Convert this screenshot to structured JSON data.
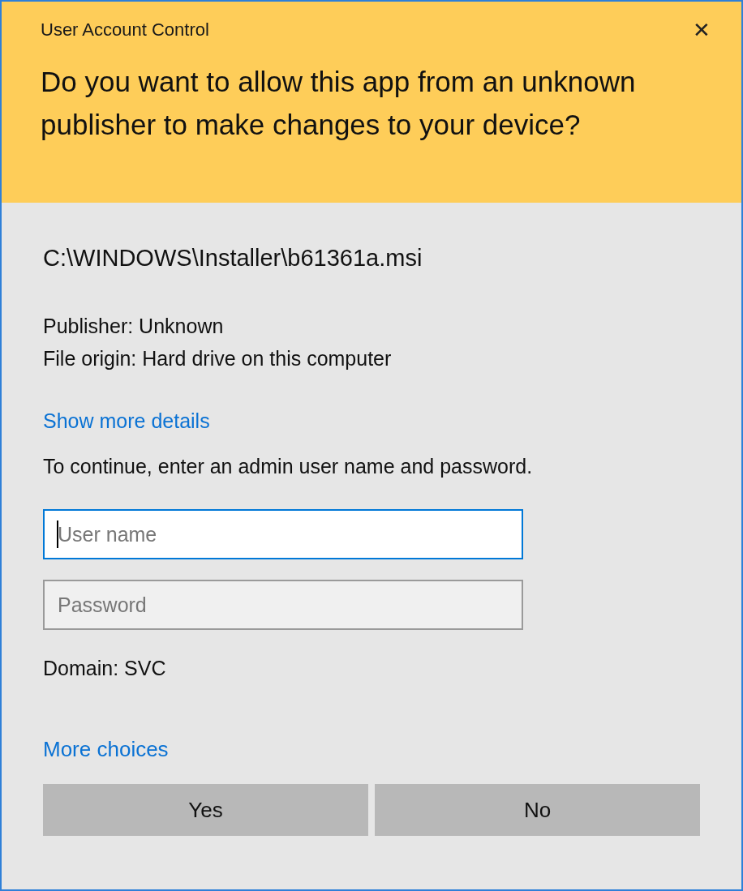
{
  "window": {
    "title": "User Account Control",
    "close": "✕"
  },
  "question": "Do you want to allow this app from an unknown publisher to make changes to your device?",
  "file_path": "C:\\WINDOWS\\Installer\\b61361a.msi",
  "details": [
    "Publisher: Unknown",
    "File origin: Hard drive on this computer"
  ],
  "show_more_link": "Show more details",
  "instruction": "To continue, enter an admin user name and password.",
  "fields": [
    {
      "placeholder": "User name",
      "focused": true
    },
    {
      "placeholder": "Password",
      "focused": false
    }
  ],
  "domain": "Domain: SVC",
  "more_choices_link": "More choices",
  "buttons": [
    "Yes",
    "No"
  ]
}
